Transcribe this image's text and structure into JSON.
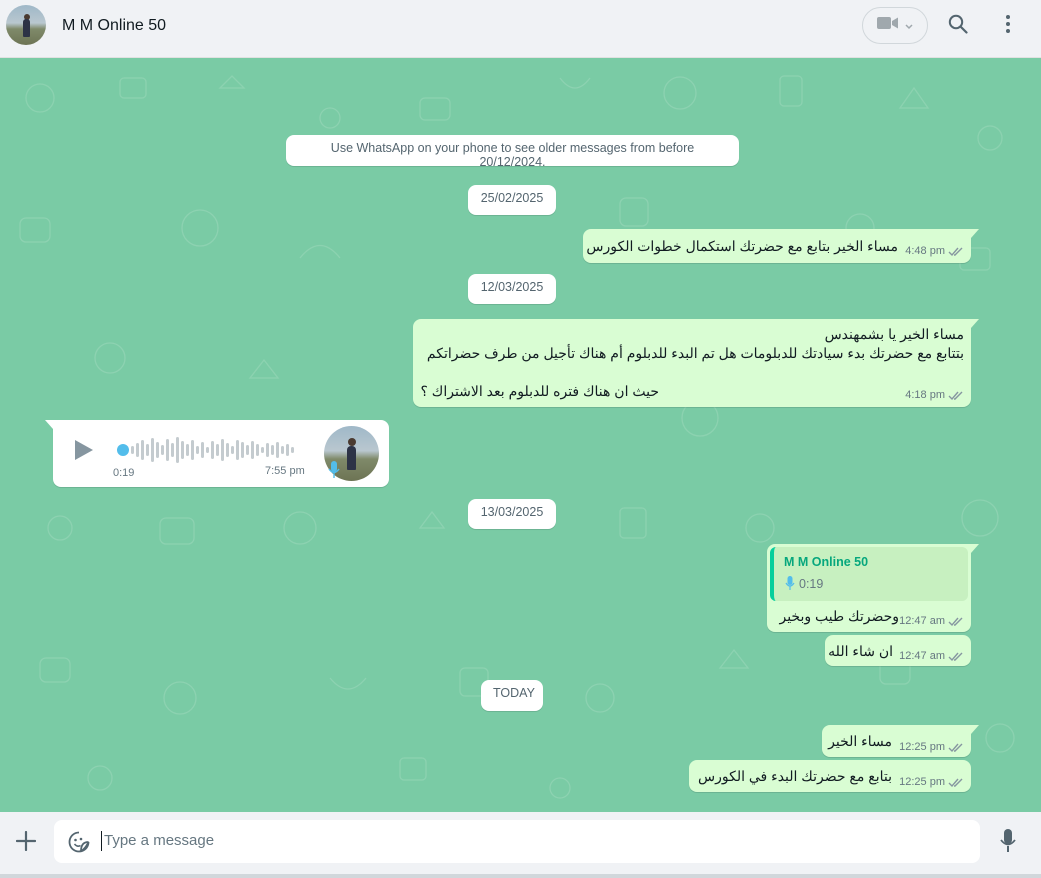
{
  "header": {
    "contact_name": "M M Online 50",
    "icons": [
      "video-call-icon",
      "chevron-down-icon",
      "search-icon",
      "menu-icon"
    ]
  },
  "chat": {
    "notice": "Use WhatsApp on your phone to see older messages from before 20/12/2024.",
    "dates": {
      "d1": "25/02/2025",
      "d2": "12/03/2025",
      "d3": "13/03/2025",
      "d4": "TODAY"
    },
    "messages": {
      "m1": {
        "text": "مساء الخير بتابع مع حضرتك استكمال خطوات الكورس",
        "time": "4:48 pm"
      },
      "m2": {
        "line1": "مساء الخير يا بشمهندس",
        "line2": "بتتابع مع حضرتك بدء سيادتك للدبلومات هل تم البدء للدبلوم أم هناك تأجيل من طرف حضراتكم",
        "line3": "حيث ان هناك فتره للدبلوم بعد الاشتراك ؟",
        "time": "4:18 pm"
      },
      "voice": {
        "duration": "0:19",
        "time": "7:55 pm"
      },
      "m3": {
        "quote_author": "M M Online 50",
        "quote_duration": "0:19",
        "text": "وحضرتك طيب وبخير",
        "time": "12:47 am"
      },
      "m4": {
        "text": "ان شاء الله",
        "time": "12:47 am"
      },
      "m5": {
        "text": "مساء الخير",
        "time": "12:25 pm"
      },
      "m6": {
        "text": "بتابع مع حضرتك البدء في الكورس",
        "time": "12:25 pm"
      }
    }
  },
  "footer": {
    "placeholder": "Type a message",
    "icons": [
      "plus-icon",
      "sticker-icon",
      "microphone-icon"
    ]
  },
  "colors": {
    "chat_bg": "#7acba5",
    "outgoing_bubble": "#d9fdd3",
    "incoming_bubble": "#ffffff",
    "accent": "#00a884",
    "quote_author": "#06cf9c",
    "voice_dot": "#53bdeb"
  }
}
